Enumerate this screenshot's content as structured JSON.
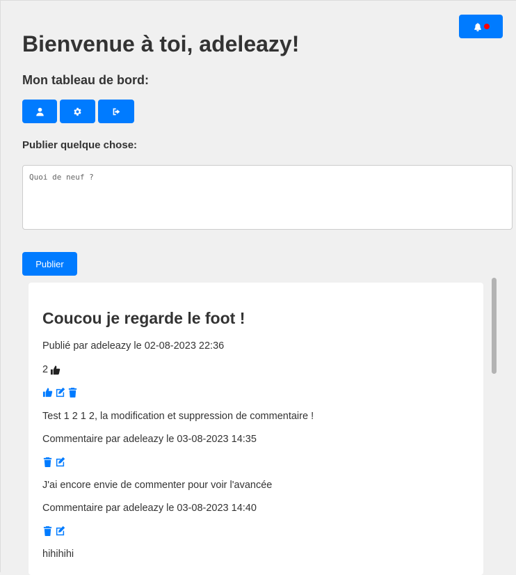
{
  "header": {
    "title": "Bienvenue à toi, adeleazy!",
    "dashboard_label": "Mon tableau de bord:",
    "buttons": [
      {
        "icon": "user-icon"
      },
      {
        "icon": "gear-icon"
      },
      {
        "icon": "logout-icon"
      }
    ],
    "notification": {
      "icon": "bell-icon",
      "unread": true
    }
  },
  "composer": {
    "label": "Publier quelque chose:",
    "placeholder": "Quoi de neuf ?",
    "value": "",
    "submit_label": "Publier"
  },
  "feed": {
    "post": {
      "title": "Coucou je regarde le foot !",
      "meta": "Publié par adeleazy le 02-08-2023 22:36",
      "likes": "2",
      "actions": [
        "thumbs-up-icon",
        "edit-icon",
        "trash-icon"
      ]
    },
    "comments": [
      {
        "text": "Test 1 2 1 2, la modification et suppression de commentaire !",
        "meta": "Commentaire par adeleazy le 03-08-2023 14:35",
        "actions": [
          "trash-icon",
          "edit-icon"
        ]
      },
      {
        "text": "J'ai encore envie de commenter pour voir l'avancée",
        "meta": "Commentaire par adeleazy le 03-08-2023 14:40",
        "actions": [
          "trash-icon",
          "edit-icon"
        ]
      },
      {
        "text": "hihihihi",
        "meta": "",
        "actions": []
      }
    ]
  },
  "colors": {
    "accent": "#007bff",
    "background": "#f0f0f0",
    "notification_dot": "#ff0000"
  }
}
